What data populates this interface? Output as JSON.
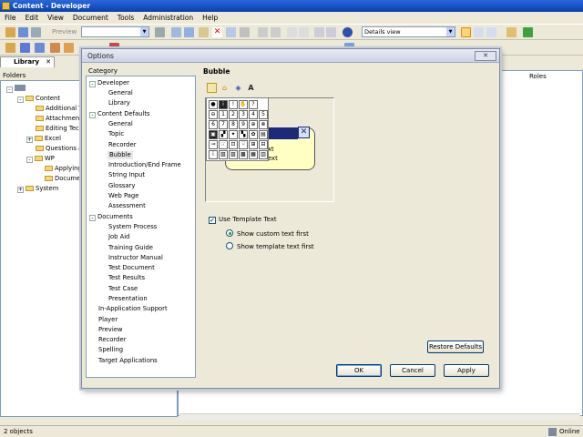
{
  "window": {
    "title": "Content - Developer"
  },
  "menu": [
    "File",
    "Edit",
    "View",
    "Document",
    "Tools",
    "Administration",
    "Help"
  ],
  "toolbar": {
    "preview_label": "Preview",
    "view_select": "Details view"
  },
  "library": {
    "tab_label": "Library",
    "folders_header": "Folders",
    "roles_header": "Roles",
    "tree": [
      {
        "label": "Content",
        "indent": 1
      },
      {
        "label": "Additional Top",
        "indent": 2
      },
      {
        "label": "Attachments",
        "indent": 2
      },
      {
        "label": "Editing Techni",
        "indent": 2
      },
      {
        "label": "Excel",
        "indent": 2
      },
      {
        "label": "Questions and",
        "indent": 2
      },
      {
        "label": "WP",
        "indent": 2
      },
      {
        "label": "Applying F",
        "indent": 3
      },
      {
        "label": "Documer",
        "indent": 3
      },
      {
        "label": "System",
        "indent": 1
      }
    ]
  },
  "status": {
    "left": "2 objects",
    "right": "Online"
  },
  "dialog": {
    "title": "Options",
    "category_label": "Category",
    "section_title": "Bubble",
    "categories": [
      {
        "label": "Developer",
        "level": 0,
        "expander": "-"
      },
      {
        "label": "General",
        "level": 1
      },
      {
        "label": "Library",
        "level": 1
      },
      {
        "label": "Content Defaults",
        "level": 0,
        "expander": "-"
      },
      {
        "label": "General",
        "level": 1
      },
      {
        "label": "Topic",
        "level": 1
      },
      {
        "label": "Recorder",
        "level": 1
      },
      {
        "label": "Bubble",
        "level": 1,
        "selected": true
      },
      {
        "label": "Introduction/End Frame",
        "level": 1
      },
      {
        "label": "String Input",
        "level": 1
      },
      {
        "label": "Glossary",
        "level": 1
      },
      {
        "label": "Web Page",
        "level": 1
      },
      {
        "label": "Assessment",
        "level": 1
      },
      {
        "label": "Documents",
        "level": 0,
        "expander": "-"
      },
      {
        "label": "System Process",
        "level": 1
      },
      {
        "label": "Job Aid",
        "level": 1
      },
      {
        "label": "Training Guide",
        "level": 1
      },
      {
        "label": "Instructor Manual",
        "level": 1
      },
      {
        "label": "Test Document",
        "level": 1
      },
      {
        "label": "Test Results",
        "level": 1
      },
      {
        "label": "Test Case",
        "level": 1
      },
      {
        "label": "Presentation",
        "level": 1
      },
      {
        "label": "In-Application Support",
        "level": 0
      },
      {
        "label": "Player",
        "level": 0
      },
      {
        "label": "Preview",
        "level": 0
      },
      {
        "label": "Recorder",
        "level": 0
      },
      {
        "label": "Spelling",
        "level": 0
      },
      {
        "label": "Target Applications",
        "level": 0
      }
    ],
    "icon_grid": [
      [
        "●",
        "i",
        "!",
        "✋",
        "?"
      ],
      [
        "⊖",
        "1",
        "2",
        "3",
        "4",
        "5"
      ],
      [
        "6",
        "7",
        "8",
        "9",
        "⊕",
        "⊗"
      ],
      [
        "▣",
        "▞",
        "✦",
        "▚",
        "✿",
        "▤"
      ],
      [
        "⊸",
        "☞",
        "⊡",
        "☟",
        "⊞",
        "⊟"
      ],
      [
        "i",
        "▧",
        "▨",
        "▩",
        "▦",
        "▥"
      ]
    ],
    "bubble_preview": {
      "line1": "xt",
      "line2": "ext"
    },
    "use_template_text": "Use Template Text",
    "radio_custom": "Show custom text first",
    "radio_template": "Show template text first",
    "restore_defaults": "Restore Defaults",
    "ok": "OK",
    "cancel": "Cancel",
    "apply": "Apply"
  }
}
